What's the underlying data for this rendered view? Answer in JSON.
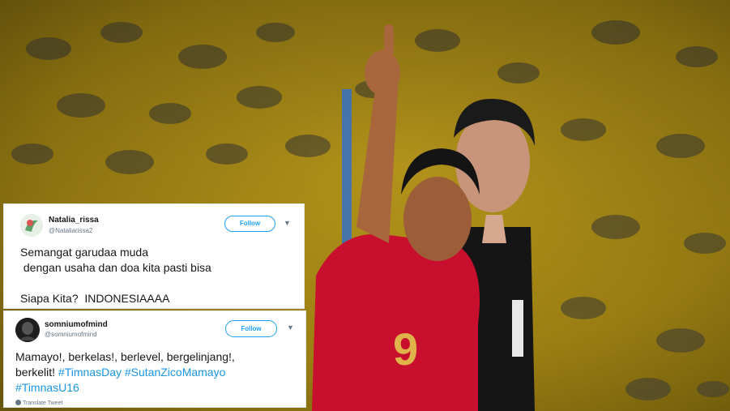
{
  "tweets": [
    {
      "user_name": "Natalia_rissa",
      "handle": "@Nataliarissa2",
      "follow_label": "Follow",
      "lines": [
        "Semangat garudaa muda",
        " dengan usaha dan doa kita pasti bisa",
        "Siapa Kita?  INDONESIAAAA"
      ]
    },
    {
      "user_name": "somniumofmind",
      "handle": "@somniumofmind",
      "follow_label": "Follow",
      "line1": "Mamayo!, berkelas!, berlevel, bergelinjang!,",
      "line2_text": "berkelit! ",
      "hashtags_line2": [
        "#TimnasDay",
        "#SutanZicoMamayo"
      ],
      "hashtags_line3": [
        "#TimnasU16"
      ],
      "translate_label": "Translate Tweet"
    }
  ],
  "colors": {
    "link": "#1b95e0",
    "follow": "#1da1f2",
    "jersey": "#c8102e",
    "stadium_seats": "#c9a21a"
  }
}
